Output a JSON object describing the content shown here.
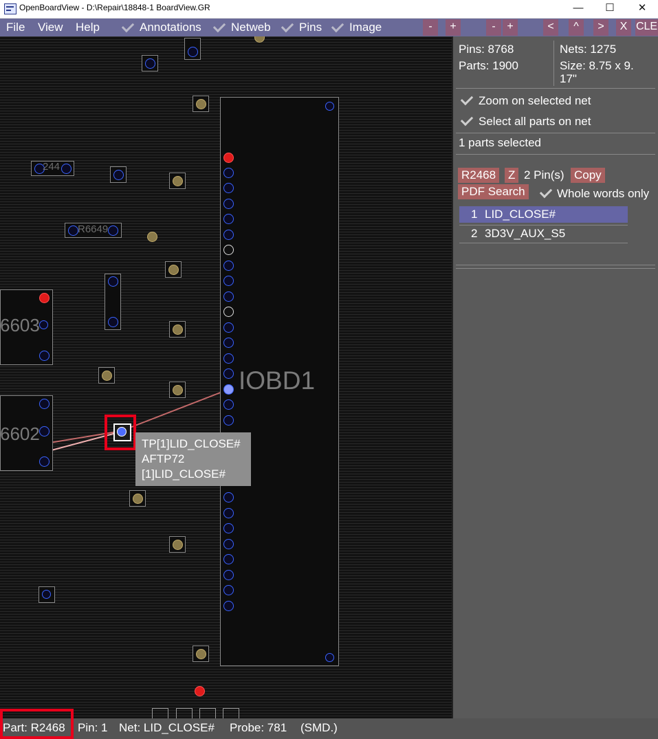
{
  "window": {
    "title": "OpenBoardView - D:\\Repair\\18848-1 BoardView.GR",
    "minimize_glyph": "—",
    "maximize_glyph": "☐",
    "close_glyph": "✕"
  },
  "menubar": {
    "file": "File",
    "view": "View",
    "help": "Help",
    "annotations": "Annotations",
    "netweb": "Netweb",
    "pins": "Pins",
    "image": "Image",
    "toolbar_buttons": [
      "-",
      "+",
      "-",
      "+",
      "<",
      "^",
      ">",
      "X",
      "CLE"
    ]
  },
  "board": {
    "labels": {
      "iobd1": "IOBD1",
      "r6603": "6603",
      "r6602": "6602",
      "r244": "244",
      "r6649": "R6649"
    },
    "tooltip": {
      "line1": "TP[1]LID_CLOSE#",
      "line2": "AFTP72",
      "line3": "[1]LID_CLOSE#"
    }
  },
  "panel": {
    "pins": "Pins: 8768",
    "parts": "Parts: 1900",
    "nets": "Nets: 1275",
    "size": "Size: 8.75 x 9.",
    "size2": "17\"",
    "zoom_on_net": "Zoom on selected net",
    "select_all_parts": "Select all parts on net",
    "parts_selected": "1 parts selected",
    "part_button": "R2468",
    "z_button": "Z",
    "pin_count": "2 Pin(s)",
    "copy_button": "Copy",
    "pdf_search_button": "PDF Search",
    "whole_words": "Whole words only",
    "nets_list": [
      {
        "num": "1",
        "name": "LID_CLOSE#"
      },
      {
        "num": "2",
        "name": "3D3V_AUX_S5"
      }
    ]
  },
  "statusbar": {
    "part": "Part: R2468",
    "pin": "Pin: 1",
    "net": "Net: LID_CLOSE#",
    "probe": "Probe: 781",
    "type": "(SMD.)"
  },
  "colors": {
    "menubar": "#6a6a98",
    "toolbar_button": "#8c5a77",
    "panel_button": "#a86060",
    "selected_net": "#6565a5",
    "highlight": "#e8001b"
  }
}
